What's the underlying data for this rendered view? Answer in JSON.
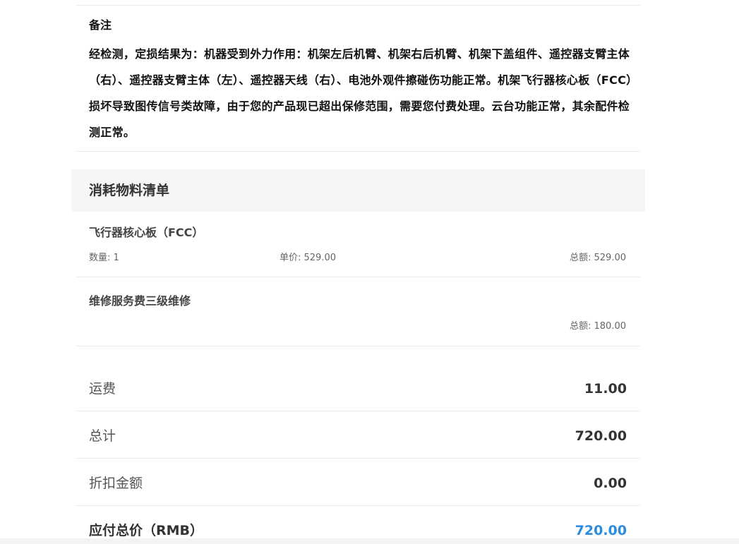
{
  "remarks": {
    "title": "备注",
    "text": "经检测，定损结果为：机器受到外力作用：机架左后机臂、机架右后机臂、机架下盖组件、遥控器支臂主体（右）、遥控器支臂主体（左）、遥控器天线（右）、电池外观件擦碰伤功能正常。机架飞行器核心板（FCC）损坏导致图传信号类故障，由于您的产品现已超出保修范围，需要您付费处理。云台功能正常，其余配件检测正常。"
  },
  "materials": {
    "title": "消耗物料清单",
    "items": [
      {
        "name": "飞行器核心板（FCC）",
        "quantity": "数量: 1",
        "unit_price": "单价: 529.00",
        "total": "总额: 529.00"
      },
      {
        "name": "维修服务费三级维修",
        "total": "总额: 180.00"
      }
    ]
  },
  "summary": {
    "shipping_label": "运费",
    "shipping_value": "11.00",
    "total_label": "总计",
    "total_value": "720.00",
    "discount_label": "折扣金额",
    "discount_value": "0.00",
    "payable_label": "应付总价（RMB）",
    "payable_value": "720.00"
  },
  "colors": {
    "accent": "#2b8ce0",
    "header_bg": "#f5f6f7"
  }
}
